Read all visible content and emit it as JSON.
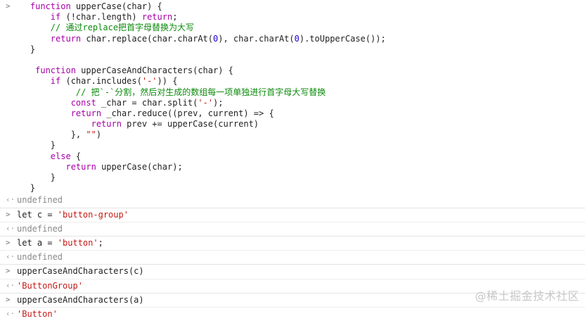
{
  "console": {
    "prompt_input": ">",
    "prompt_output": "‹·",
    "code_block": [
      "    function upperCase(char) {",
      "        if (!char.length) return;",
      "        // 通过replace把首字母替换为大写",
      "        return char.replace(char.charAt(0), char.charAt(0).toUpperCase());",
      "    }",
      "",
      "     function upperCaseAndCharacters(char) {",
      "        if (char.includes('-')) {",
      "             // 把`-`分割，然后对生成的数组每一项单独进行首字母大写替换",
      "            const _char = char.split('-');",
      "            return _char.reduce((prev, current) => {",
      "                return prev += upperCase(current)",
      "            }, \"\")",
      "        }",
      "        else {",
      "           return upperCase(char);",
      "        }",
      "    }"
    ],
    "entries": [
      {
        "type": "output",
        "text": "undefined",
        "style": "undef"
      },
      {
        "type": "input",
        "text": "let c = 'button-group'"
      },
      {
        "type": "output",
        "text": "undefined",
        "style": "undef"
      },
      {
        "type": "input",
        "text": "let a = 'button';"
      },
      {
        "type": "output",
        "text": "undefined",
        "style": "undef"
      },
      {
        "type": "input",
        "text": "upperCaseAndCharacters(c)"
      },
      {
        "type": "output",
        "text": "'ButtonGroup'",
        "style": "result"
      },
      {
        "type": "input",
        "text": "upperCaseAndCharacters(a)"
      },
      {
        "type": "output",
        "text": "'Button'",
        "style": "result"
      }
    ]
  },
  "watermark": "@稀土掘金技术社区"
}
